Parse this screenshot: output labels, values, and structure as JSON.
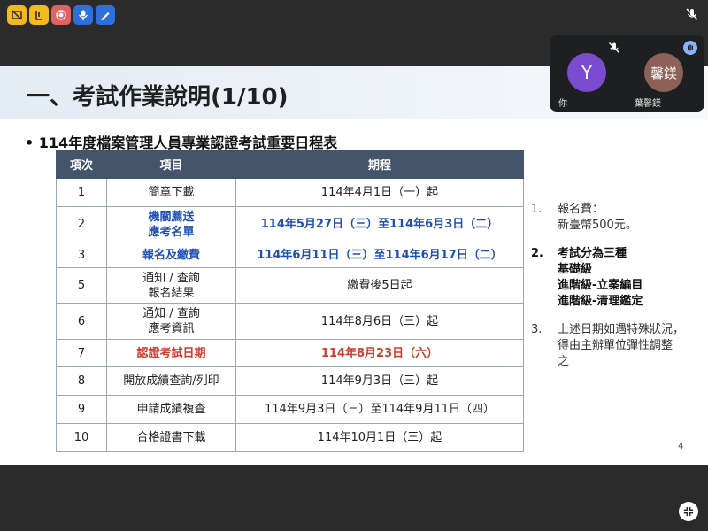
{
  "toolbar": {
    "colors": [
      "#f2b920",
      "#f2b920",
      "#e06262",
      "#2f6fd9",
      "#2f6fd9"
    ],
    "icons": [
      "grid-off-icon",
      "timer-icon",
      "record-icon",
      "mic-edit-icon",
      "pen-icon"
    ]
  },
  "slide": {
    "title": "一、考試作業說明(1/10)",
    "subtitle": "• 114年度檔案管理人員專業認證考試重要日程表",
    "table": {
      "headers": [
        "項次",
        "項目",
        "期程"
      ],
      "rows": [
        {
          "no": "1",
          "item": [
            "簡章下載"
          ],
          "period": "114年4月1日（一）起",
          "style": "normal"
        },
        {
          "no": "2",
          "item": [
            "機關薦送",
            "應考名單"
          ],
          "period": "114年5月27日（三）至114年6月3日（二）",
          "style": "blue"
        },
        {
          "no": "3",
          "item": [
            "報名及繳費"
          ],
          "period": "114年6月11日（三）至114年6月17日（二）",
          "style": "blue"
        },
        {
          "no": "5",
          "item": [
            "通知 / 查詢",
            "報名結果"
          ],
          "period": "繳費後5日起",
          "style": "normal"
        },
        {
          "no": "6",
          "item": [
            "通知 / 查詢",
            "應考資訊"
          ],
          "period": "114年8月6日（三）起",
          "style": "normal"
        },
        {
          "no": "7",
          "item": [
            "認證考試日期"
          ],
          "period": "114年8月23日（六）",
          "style": "red"
        },
        {
          "no": "8",
          "item": [
            "開放成績查詢/列印"
          ],
          "period": "114年9月3日（三）起",
          "style": "normal"
        },
        {
          "no": "9",
          "item": [
            "申請成績複查"
          ],
          "period": "114年9月3日（三）至114年9月11日（四）",
          "style": "normal"
        },
        {
          "no": "10",
          "item": [
            "合格證書下載"
          ],
          "period": "114年10月1日（三）起",
          "style": "normal"
        }
      ]
    },
    "notes": [
      {
        "num": "1.",
        "lines": [
          "報名費：",
          "新臺幣500元。"
        ],
        "bold": false
      },
      {
        "num": "2.",
        "lines": [
          "考試分為三種",
          "基礎級",
          "進階級-立案編目",
          "進階級-清理鑑定"
        ],
        "bold": true
      },
      {
        "num": "3.",
        "lines": [
          "上述日期如遇特殊狀況，",
          "得由主辦單位彈性調整",
          "之"
        ],
        "bold": false
      }
    ],
    "page_number": "4"
  },
  "video": {
    "participants": [
      {
        "avatar": "Y",
        "name": "你",
        "color": "#7b4ccf"
      },
      {
        "avatar": "馨鎂",
        "name": "葉馨鎂",
        "color": "#8c6157"
      }
    ]
  }
}
